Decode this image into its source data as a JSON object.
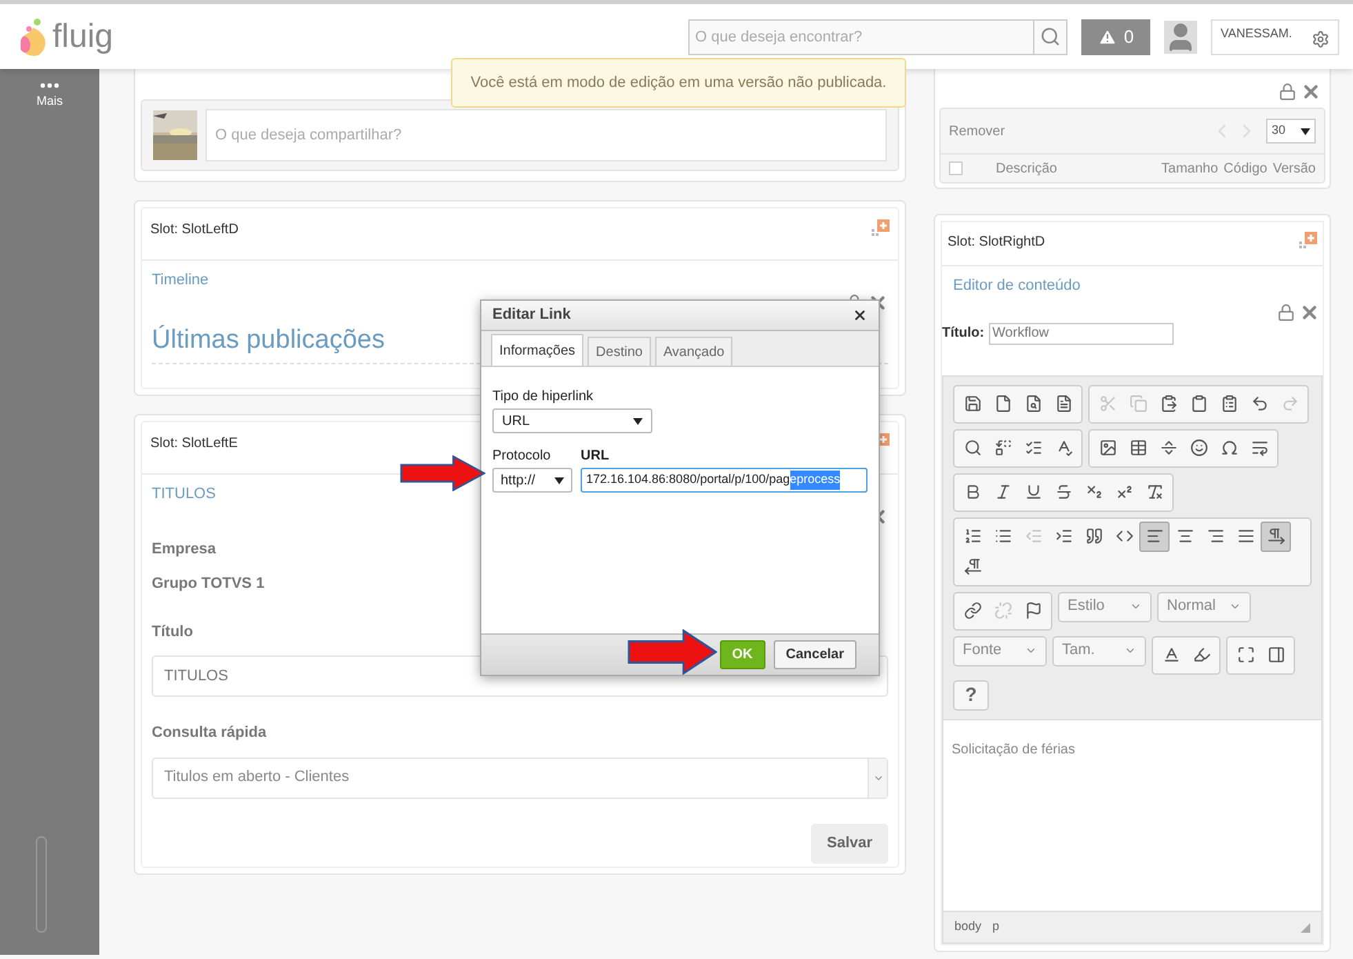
{
  "header": {
    "logo_text": "fluig",
    "search_placeholder": "O que deseja encontrar?",
    "alerts_count": "0",
    "user_name": "VANESSAM."
  },
  "sidebar": {
    "more_label": "Mais"
  },
  "notice": "Você está em modo de edição em uma versão não publicada.",
  "share": {
    "placeholder": "O que deseja compartilhar?"
  },
  "slot_left_d": {
    "slot_title": "Slot: SlotLeftD",
    "widget_title": "Timeline",
    "heading": "Últimas publicações"
  },
  "slot_left_e": {
    "slot_title": "Slot: SlotLeftE",
    "widget_title": "TITULOS",
    "fields": [
      {
        "kind": "static",
        "label": "Empresa",
        "value": "Grupo TOTVS 1"
      },
      {
        "kind": "input",
        "label": "Título",
        "value": "TITULOS"
      },
      {
        "kind": "select",
        "label": "Consulta rápida",
        "value": "Titulos em aberto - Clientes"
      }
    ],
    "save_button": "Salvar"
  },
  "documents": {
    "remove_label": "Remover",
    "page_size": "30",
    "select_all_checked": false,
    "columns": [
      "Descrição",
      "Tamanho",
      "Código",
      "Versão"
    ]
  },
  "slot_right_d": {
    "slot_title": "Slot: SlotRightD",
    "widget_title": "Editor de conteúdo",
    "title_label": "Título:",
    "title_value": "Workflow",
    "toolbar_groups": [
      {
        "kind": "icons",
        "items": [
          {
            "disabled": false,
            "pressed": false
          },
          {
            "disabled": false,
            "pressed": false
          },
          {
            "disabled": false,
            "pressed": false
          },
          {
            "disabled": false,
            "pressed": false
          }
        ]
      },
      {
        "kind": "icons",
        "items": [
          {
            "disabled": true,
            "pressed": false
          },
          {
            "disabled": true,
            "pressed": false
          },
          {
            "disabled": false,
            "pressed": false
          },
          {
            "disabled": false,
            "pressed": false
          },
          {
            "disabled": false,
            "pressed": false
          },
          {
            "disabled": false,
            "pressed": false
          },
          {
            "disabled": true,
            "pressed": false
          }
        ]
      },
      {
        "kind": "icons",
        "items": [
          {
            "disabled": false,
            "pressed": false
          },
          {
            "disabled": false,
            "pressed": false
          },
          {
            "disabled": false,
            "pressed": false
          },
          {
            "disabled": false,
            "pressed": false
          }
        ]
      },
      {
        "kind": "icons",
        "items": [
          {
            "disabled": false,
            "pressed": false
          },
          {
            "disabled": false,
            "pressed": false
          },
          {
            "disabled": false,
            "pressed": false
          },
          {
            "disabled": false,
            "pressed": false
          },
          {
            "disabled": false,
            "pressed": false
          },
          {
            "disabled": false,
            "pressed": false
          }
        ]
      },
      {
        "kind": "icons",
        "items": [
          {
            "disabled": false,
            "pressed": false
          },
          {
            "disabled": false,
            "pressed": false
          },
          {
            "disabled": false,
            "pressed": false
          },
          {
            "disabled": false,
            "pressed": false
          },
          {
            "disabled": false,
            "pressed": false
          },
          {
            "disabled": false,
            "pressed": false
          },
          {
            "disabled": false,
            "pressed": false
          }
        ]
      },
      {
        "kind": "icons",
        "items": [
          {
            "disabled": false,
            "pressed": false
          },
          {
            "disabled": false,
            "pressed": false
          },
          {
            "disabled": true,
            "pressed": false
          },
          {
            "disabled": false,
            "pressed": false
          },
          {
            "disabled": false,
            "pressed": false
          },
          {
            "disabled": false,
            "pressed": false
          },
          {
            "disabled": false,
            "pressed": true
          },
          {
            "disabled": false,
            "pressed": false
          },
          {
            "disabled": false,
            "pressed": false
          },
          {
            "disabled": false,
            "pressed": false
          },
          {
            "disabled": false,
            "pressed": true
          },
          {
            "disabled": false,
            "pressed": false
          }
        ]
      },
      {
        "kind": "icons",
        "items": [
          {
            "disabled": false,
            "pressed": false
          },
          {
            "disabled": true,
            "pressed": false
          },
          {
            "disabled": false,
            "pressed": false
          }
        ]
      },
      {
        "kind": "combo",
        "label": "Estilo"
      },
      {
        "kind": "combo",
        "label": "Normal"
      },
      {
        "kind": "combo",
        "label": "Fonte"
      },
      {
        "kind": "combo",
        "label": "Tam."
      },
      {
        "kind": "icons",
        "items": [
          {
            "disabled": false,
            "pressed": false
          },
          {
            "disabled": false,
            "pressed": false
          }
        ]
      },
      {
        "kind": "icons",
        "items": [
          {
            "disabled": false,
            "pressed": false
          },
          {
            "disabled": false,
            "pressed": false
          }
        ]
      },
      {
        "kind": "text",
        "label": "?"
      }
    ],
    "content": "Solicitação de férias",
    "path": [
      "body",
      "p"
    ]
  },
  "dialog": {
    "title": "Editar Link",
    "tabs": [
      {
        "label": "Informações",
        "selected": true
      },
      {
        "label": "Destino",
        "selected": false
      },
      {
        "label": "Avançado",
        "selected": false
      }
    ],
    "link_type_label": "Tipo de hiperlink",
    "link_type": "URL",
    "protocol_label": "Protocolo",
    "protocol": "http://",
    "url_label": "URL",
    "url_value": "172.16.104.86:8080/portal/p/100/pag",
    "url_selected": "eprocess",
    "buttons": [
      {
        "label": "OK",
        "kind": "primary"
      },
      {
        "label": "Cancelar",
        "kind": "default"
      }
    ]
  }
}
